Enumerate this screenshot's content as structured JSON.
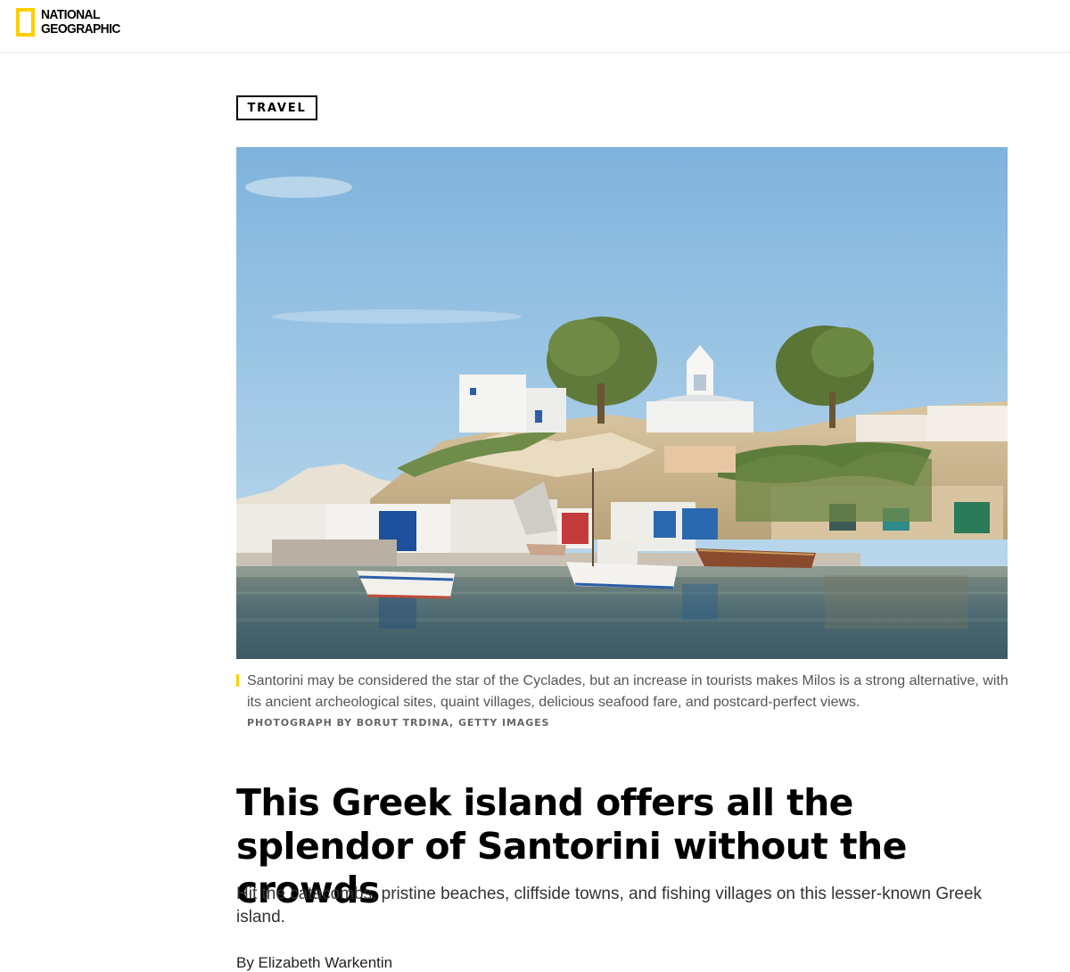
{
  "header": {
    "logo_line1": "NATIONAL",
    "logo_line2": "GEOGRAPHIC",
    "logo_color": "#ffce00"
  },
  "article": {
    "kicker": "TRAVEL",
    "caption": "Santorini may be considered the star of the Cyclades, but an increase in tourists makes Milos is a strong alternative, with its ancient archeological sites, quaint villages, delicious seafood fare, and postcard-perfect views.",
    "credit": "PHOTOGRAPH BY BORUT TRDINA, GETTY IMAGES",
    "headline": "This Greek island offers all the splendor of Santorini without the crowds",
    "dek": "Hit the catacombs, pristine beaches, cliffside towns, and fishing villages on this lesser-known Greek island.",
    "byline": "By Elizabeth Warkentin"
  }
}
